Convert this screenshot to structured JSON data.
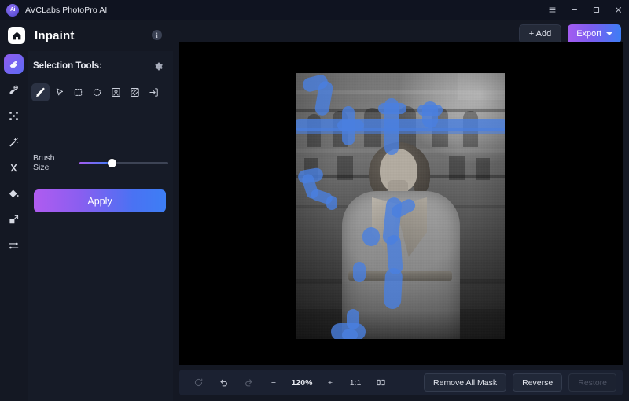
{
  "window": {
    "app_title": "AVCLabs PhotoPro AI",
    "logo_text": "Ai",
    "controls": [
      {
        "name": "menu",
        "icon": "hamburger-icon"
      },
      {
        "name": "minimize",
        "icon": "minimize-icon"
      },
      {
        "name": "maximize",
        "icon": "maximize-icon"
      },
      {
        "name": "close",
        "icon": "close-icon"
      }
    ]
  },
  "header": {
    "home_icon": "home-icon",
    "title": "Inpaint",
    "info_icon": "info-icon",
    "info_label": "i",
    "add_label": "+ Add",
    "export_label": "Export"
  },
  "rail": {
    "items": [
      {
        "name": "inpaint",
        "icon": "inpaint-eraser-icon",
        "active": true
      },
      {
        "name": "ai-retouch",
        "icon": "ai-retouch-icon",
        "active": false
      },
      {
        "name": "enhance",
        "icon": "enhance-expand-icon",
        "active": false
      },
      {
        "name": "magic-wand",
        "icon": "magic-wand-icon",
        "active": false
      },
      {
        "name": "background-remove",
        "icon": "scissors-crop-icon",
        "active": false
      },
      {
        "name": "colorize",
        "icon": "paint-bucket-icon",
        "active": false
      },
      {
        "name": "upscale",
        "icon": "upscale-resize-icon",
        "active": false
      },
      {
        "name": "adjustments",
        "icon": "sliders-icon",
        "active": false
      }
    ]
  },
  "panel": {
    "title": "Selection Tools:",
    "gear_icon": "gear-icon",
    "tools": [
      {
        "name": "brush-tool",
        "icon": "brush-icon",
        "active": true
      },
      {
        "name": "cursor-tool",
        "icon": "cursor-arrow-icon",
        "active": false
      },
      {
        "name": "rectangle-select-tool",
        "icon": "rectangle-dashed-icon",
        "active": false
      },
      {
        "name": "ellipse-select-tool",
        "icon": "ellipse-dashed-icon",
        "active": false
      },
      {
        "name": "subject-select-tool",
        "icon": "portrait-person-icon",
        "active": false
      },
      {
        "name": "hatch-select-tool",
        "icon": "hatched-box-icon",
        "active": false
      },
      {
        "name": "import-mask-tool",
        "icon": "import-arrow-icon",
        "active": false
      }
    ],
    "brush_size_label": "Brush Size",
    "brush_size_percent": 35,
    "apply_label": "Apply"
  },
  "canvas": {
    "image_alt": "black and white photo of a woman in a coat in front of a building with blue mask strokes",
    "brush_cursor": "brush-cursor-circle"
  },
  "bottombar": {
    "reset_icon": "reset-refresh-icon",
    "undo_icon": "undo-icon",
    "redo_icon": "redo-icon",
    "zoom_out_label": "−",
    "zoom_value": "120%",
    "zoom_in_label": "+",
    "fit_label": "1:1",
    "compare_icon": "compare-split-icon",
    "remove_all_mask_label": "Remove All Mask",
    "reverse_label": "Reverse",
    "restore_label": "Restore"
  },
  "colors": {
    "accent_purple": "#a45cf0",
    "accent_blue": "#3d7ef5",
    "mask_blue": "#4a7fe0",
    "panel_bg": "#161b27",
    "app_bg": "#141823",
    "canvas_bg": "#000000"
  }
}
